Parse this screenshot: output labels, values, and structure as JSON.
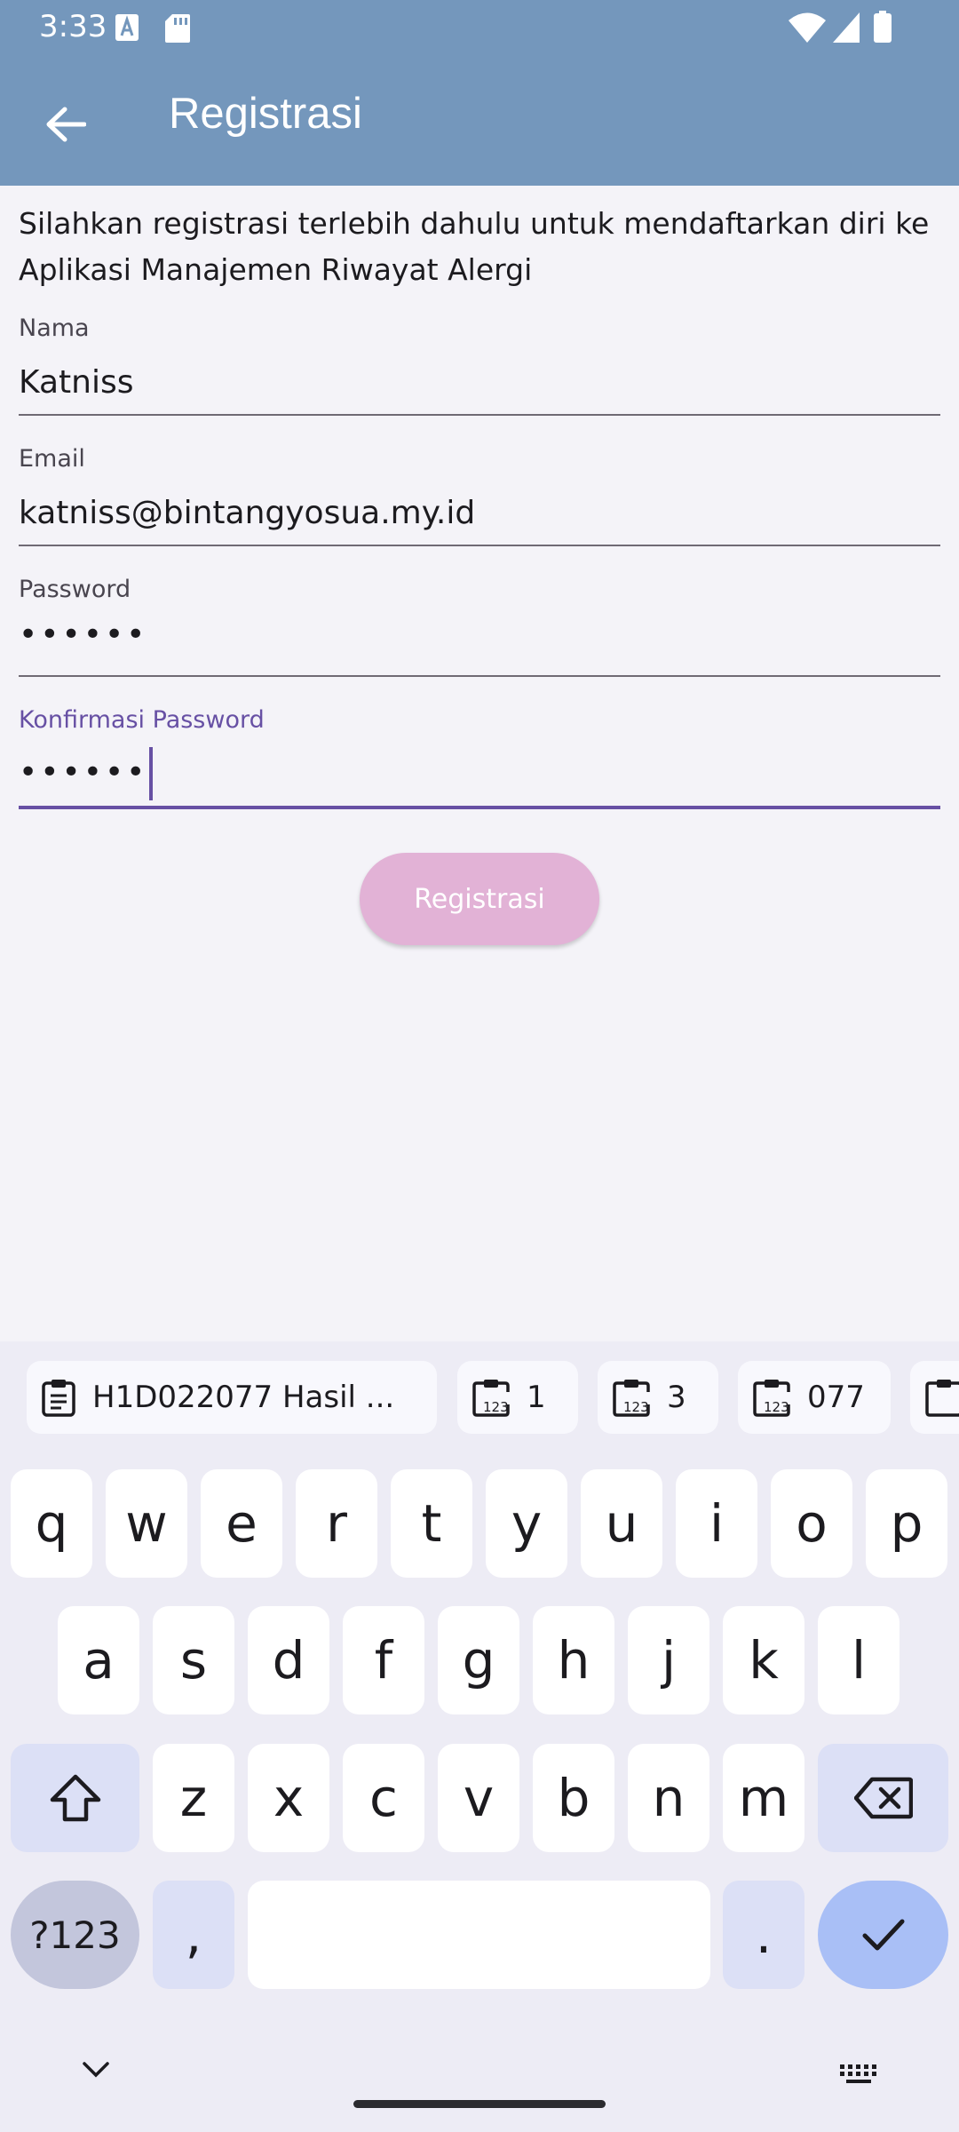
{
  "status": {
    "time": "3:33"
  },
  "appbar": {
    "title": "Registrasi"
  },
  "intro": "Silahkan registrasi terlebih dahulu untuk mendaftarkan diri ke Aplikasi Manajemen Riwayat Alergi",
  "form": {
    "name": {
      "label": "Nama",
      "value": "Katniss"
    },
    "email": {
      "label": "Email",
      "value": "katniss@bintangyosua.my.id"
    },
    "password": {
      "label": "Password",
      "value": "••••••"
    },
    "confirm": {
      "label": "Konfirmasi Password",
      "value": "••••••"
    },
    "submit_label": "Registrasi"
  },
  "keyboard": {
    "clipboard": [
      {
        "text": "H1D022077 Hasil ...",
        "icon": "clipboard-icon"
      },
      {
        "text": "1",
        "icon": "clipboard-numbers-icon"
      },
      {
        "text": "3",
        "icon": "clipboard-numbers-icon"
      },
      {
        "text": "077",
        "icon": "clipboard-numbers-icon"
      }
    ],
    "row1": [
      "q",
      "w",
      "e",
      "r",
      "t",
      "y",
      "u",
      "i",
      "o",
      "p"
    ],
    "row2": [
      "a",
      "s",
      "d",
      "f",
      "g",
      "h",
      "j",
      "k",
      "l"
    ],
    "row3": [
      "z",
      "x",
      "c",
      "v",
      "b",
      "n",
      "m"
    ],
    "sym_label": "?123",
    "comma": ",",
    "period": "."
  },
  "colors": {
    "appbar": "#7497bc",
    "accent": "#6750a4",
    "button": "#e2b2d6"
  }
}
